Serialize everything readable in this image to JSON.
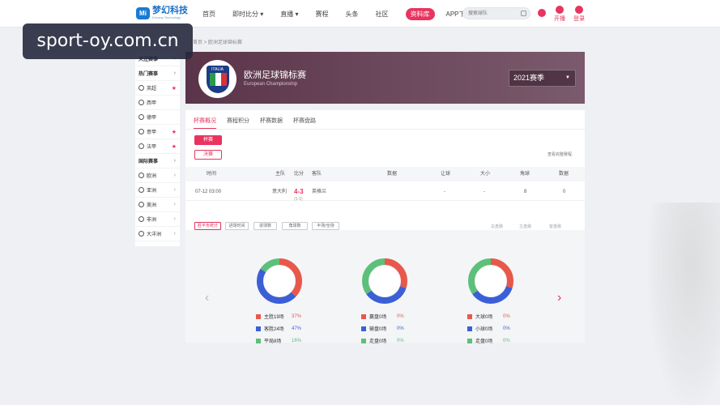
{
  "brand": {
    "name": "梦幻科技",
    "sub": "Dreamy Technology",
    "mark": "Mi"
  },
  "nav": {
    "items": [
      "首页",
      "即时比分 ▾",
      "直播 ▾",
      "赛程",
      "头条",
      "社区",
      "资料库",
      "APP下载"
    ],
    "active_index": 6
  },
  "search": {
    "placeholder": "搜索球队"
  },
  "user_actions": {
    "broadcast": "开播",
    "login": "登录"
  },
  "watermark": "sport-oy.com.cn",
  "breadcrumb": "首页 > 欧洲足球锦标赛",
  "sidebar": {
    "items": [
      {
        "label": "关注赛事",
        "type": "header",
        "mark": "chev"
      },
      {
        "label": "热门赛事",
        "type": "header",
        "mark": "chev"
      },
      {
        "label": "英超",
        "type": "item",
        "mark": "star"
      },
      {
        "label": "西甲",
        "type": "item",
        "mark": ""
      },
      {
        "label": "德甲",
        "type": "item",
        "mark": ""
      },
      {
        "label": "意甲",
        "type": "item",
        "mark": "star"
      },
      {
        "label": "法甲",
        "type": "item",
        "mark": "star"
      },
      {
        "label": "国际赛事",
        "type": "header",
        "mark": "chev"
      },
      {
        "label": "欧洲",
        "type": "item",
        "mark": "chev"
      },
      {
        "label": "亚洲",
        "type": "item",
        "mark": "chev"
      },
      {
        "label": "美洲",
        "type": "item",
        "mark": "chev"
      },
      {
        "label": "非洲",
        "type": "item",
        "mark": "chev"
      },
      {
        "label": "大洋洲",
        "type": "item",
        "mark": "chev"
      }
    ]
  },
  "league": {
    "emblem_label": "ITALIA",
    "title": "欧洲足球锦标赛",
    "subtitle": "European Championship",
    "season": "2021赛季"
  },
  "tabs": [
    "杯赛概况",
    "赛程积分",
    "杯赛数据",
    "杯赛盘路"
  ],
  "stages": [
    "杯赛",
    "决赛"
  ],
  "stage_link": "查看完整赛程",
  "table": {
    "headers": [
      "时间",
      "主队",
      "比分",
      "客队",
      "数据",
      "让球",
      "大小",
      "角球",
      "数据"
    ],
    "rows": [
      {
        "time": "07-12 03:00",
        "home": "意大利",
        "score": "4-3",
        "score_sub": "(1-1)",
        "away": "英格兰",
        "data": "",
        "handicap": "-",
        "ou": "-",
        "corner": "8",
        "data2": "0"
      }
    ]
  },
  "filters": [
    "胜平负统计",
    "进球时间",
    "进球数",
    "角球数",
    "半场/全场"
  ],
  "filters_right": [
    "总盘路",
    "主盘路",
    "客盘路"
  ],
  "colors": {
    "accent": "#e8345e",
    "red": "#e8584a",
    "blue": "#3b5fd6",
    "green": "#5cc07a"
  },
  "chart_data": [
    {
      "type": "pie",
      "labels": [
        "主胜19场",
        "客胜24场",
        "平局8场"
      ],
      "values": [
        37,
        47,
        16
      ],
      "value_labels": [
        "37%",
        "47%",
        "16%"
      ],
      "colors": [
        "#e8584a",
        "#3b5fd6",
        "#5cc07a"
      ]
    },
    {
      "type": "pie",
      "labels": [
        "赢盘0场",
        "输盘0场",
        "走盘0场"
      ],
      "values": [
        0,
        0,
        0
      ],
      "value_labels": [
        "0%",
        "0%",
        "0%"
      ],
      "colors": [
        "#e8584a",
        "#3b5fd6",
        "#5cc07a"
      ],
      "display_values": [
        30,
        35,
        35
      ]
    },
    {
      "type": "pie",
      "labels": [
        "大球0场",
        "小球0场",
        "走盘0场"
      ],
      "values": [
        0,
        0,
        0
      ],
      "value_labels": [
        "0%",
        "0%",
        "0%"
      ],
      "colors": [
        "#e8584a",
        "#3b5fd6",
        "#5cc07a"
      ],
      "display_values": [
        30,
        35,
        35
      ]
    }
  ]
}
